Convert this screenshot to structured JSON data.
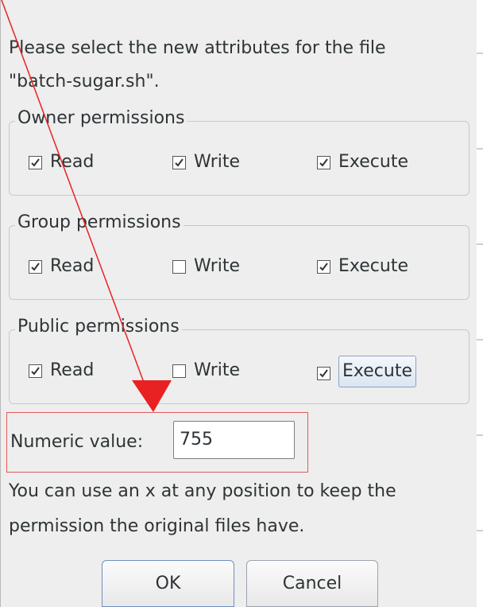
{
  "dialog": {
    "prompt_line1": "Please select the new attributes for the file",
    "prompt_line2": "\"batch-sugar.sh\"."
  },
  "groups": [
    {
      "title": "Owner permissions",
      "read": {
        "label": "Read",
        "checked": true
      },
      "write": {
        "label": "Write",
        "checked": true
      },
      "execute": {
        "label": "Execute",
        "checked": true
      }
    },
    {
      "title": "Group permissions",
      "read": {
        "label": "Read",
        "checked": true
      },
      "write": {
        "label": "Write",
        "checked": false
      },
      "execute": {
        "label": "Execute",
        "checked": true
      }
    },
    {
      "title": "Public permissions",
      "read": {
        "label": "Read",
        "checked": true
      },
      "write": {
        "label": "Write",
        "checked": false
      },
      "execute": {
        "label": "Execute",
        "checked": true
      }
    }
  ],
  "numeric": {
    "label": "Numeric value:",
    "value": "755"
  },
  "hint": {
    "line1": "You can use an x at any position to keep the",
    "line2": "permission the original files have."
  },
  "buttons": {
    "ok": "OK",
    "cancel": "Cancel"
  },
  "colors": {
    "annotation": "#e82222",
    "background": "#eeeeee"
  }
}
